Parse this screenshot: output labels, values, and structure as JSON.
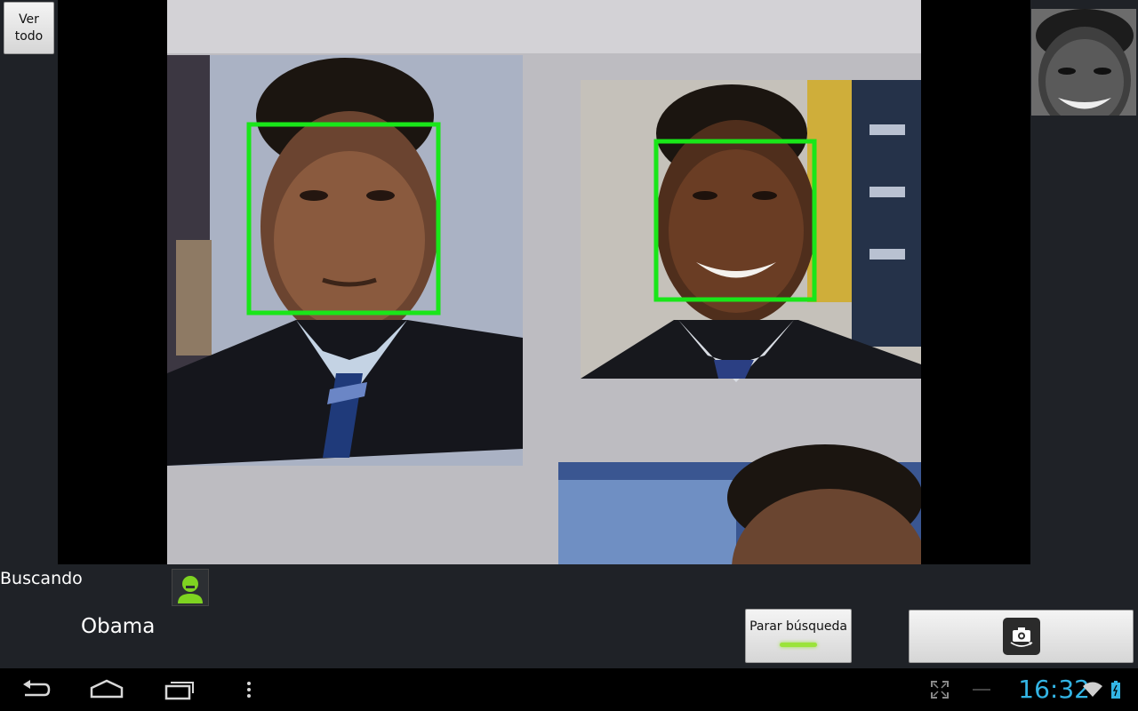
{
  "app": {
    "view_all_button": {
      "line1": "Ver",
      "line2": "todo"
    },
    "status_text": "Buscando",
    "person_name": "Obama",
    "stop_search_button": "Parar búsqueda",
    "switch_camera_button_icon": "camera-switch-icon",
    "detected_faces_count": 2,
    "face_box_color": "#19e619",
    "status_icon_color": "#7ed321"
  },
  "system_bar": {
    "nav_icons": [
      "back-icon",
      "home-icon",
      "recent-apps-icon",
      "menu-icon"
    ],
    "status_icons": [
      "fullscreen-icon",
      "wifi-icon",
      "battery-icon"
    ],
    "time": "16:32",
    "time_color": "#33b5e5"
  }
}
